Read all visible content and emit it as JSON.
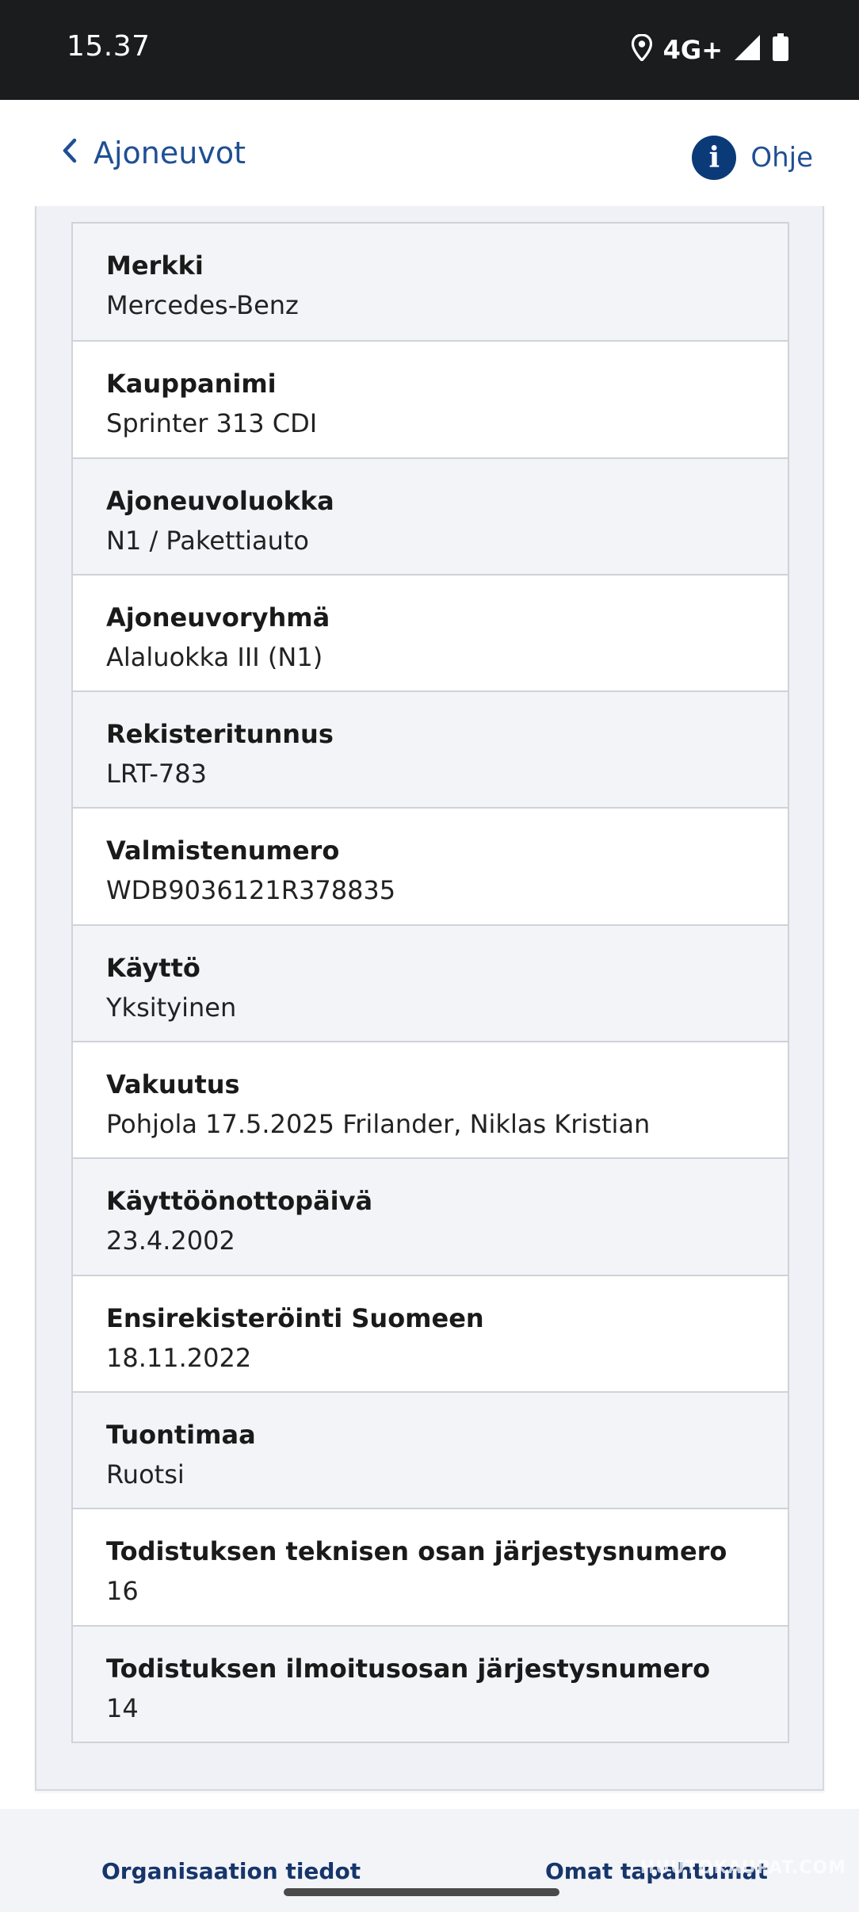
{
  "status_bar": {
    "time": "15.37",
    "network": "4G+",
    "icons": [
      "location-icon",
      "signal-icon",
      "battery-icon"
    ]
  },
  "header": {
    "back_label": "Ajoneuvot",
    "help_label": "Ohje",
    "help_glyph": "i",
    "accent_color": "#1f4f94",
    "help_icon_color": "#0b3a78"
  },
  "details": [
    {
      "label": "Merkki",
      "value": "Mercedes-Benz"
    },
    {
      "label": "Kauppanimi",
      "value": "Sprinter 313 CDI"
    },
    {
      "label": "Ajoneuvoluokka",
      "value": "N1 / Pakettiauto"
    },
    {
      "label": "Ajoneuvoryhmä",
      "value": "Alaluokka III (N1)"
    },
    {
      "label": "Rekisteritunnus",
      "value": "LRT-783"
    },
    {
      "label": "Valmistenumero",
      "value": "WDB9036121R378835"
    },
    {
      "label": "Käyttö",
      "value": "Yksityinen"
    },
    {
      "label": "Vakuutus",
      "value": "Pohjola 17.5.2025 Frilander, Niklas Kristian"
    },
    {
      "label": "Käyttöönottopäivä",
      "value": "23.4.2002"
    },
    {
      "label": "Ensirekisteröinti Suomeen",
      "value": "18.11.2022"
    },
    {
      "label": "Tuontimaa",
      "value": "Ruotsi"
    },
    {
      "label": "Todistuksen teknisen osan järjestysnumero",
      "value": "16"
    },
    {
      "label": "Todistuksen ilmoitusosan järjestysnumero",
      "value": "14"
    }
  ],
  "footer": {
    "left_link": "Organisaation tiedot",
    "right_link": "Omat tapahtumat",
    "watermark": "HUUTOKAUPAT.COM"
  }
}
